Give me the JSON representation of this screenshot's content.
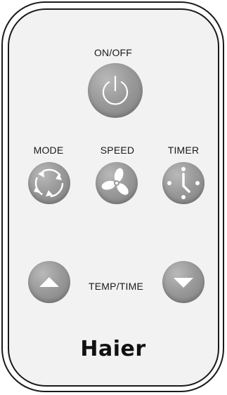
{
  "buttons": {
    "power_label": "ON/OFF",
    "mode_label": "MODE",
    "speed_label": "SPEED",
    "timer_label": "TIMER",
    "temp_time_label": "TEMP/TIME"
  },
  "brand": {
    "name": "Haier"
  },
  "icons": {
    "power": "power-icon",
    "mode": "cycle-arrows-icon",
    "speed": "fan-icon",
    "timer": "clock-icon",
    "up": "triangle-up-icon",
    "down": "triangle-down-icon"
  },
  "colors": {
    "button": "#9a9a9a",
    "body": "#f2f2f2",
    "outline": "#1a1a1a"
  }
}
